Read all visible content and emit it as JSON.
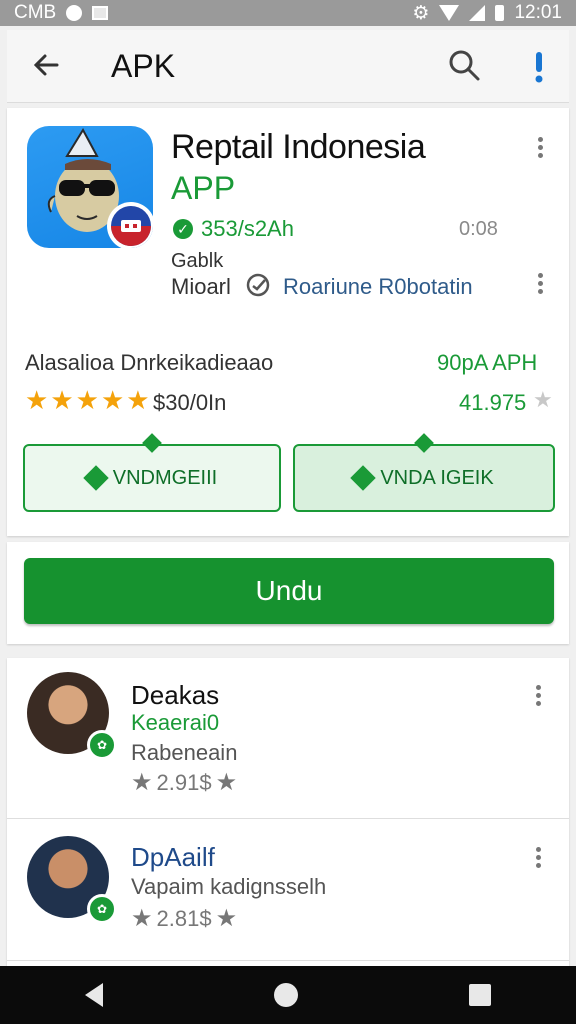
{
  "status_bar": {
    "carrier": "CMB",
    "time": "12:01"
  },
  "header": {
    "title": "APK"
  },
  "app": {
    "name": "Reptail Indonesia",
    "subtitle": "APP",
    "verify_text": "353/s2Ah",
    "top_count": "0:08",
    "category": "Gablk",
    "developer_label": "Mioarl",
    "developer_name": "Roariune R0botatin",
    "description": "Alasalioa Dnrkeikadieaao",
    "price": "90pA APH",
    "rating_text": "$30/0In",
    "score": "41.975",
    "star_count": 5,
    "button_left": "VNDMGEIII",
    "button_right": "VNDA IGEIK",
    "install_label": "Undu"
  },
  "reviews": [
    {
      "name": "Deakas",
      "subtitle": "Keaerai0",
      "line": "Rabeneain",
      "rating": "2.91$"
    },
    {
      "name": "DpAailf",
      "subtitle": "",
      "line": "Vapaim kadignsselh",
      "rating": "2.81$"
    }
  ],
  "colors": {
    "accent": "#1a9a37",
    "install_button": "#16922f",
    "developer_text": "#2f5b8a",
    "star_gold": "#f4a20b"
  },
  "icons": [
    "back-arrow-icon",
    "search-icon",
    "info-icon",
    "verified-icon",
    "developer-icon",
    "more-options-icon",
    "download-icon",
    "star-icon"
  ]
}
